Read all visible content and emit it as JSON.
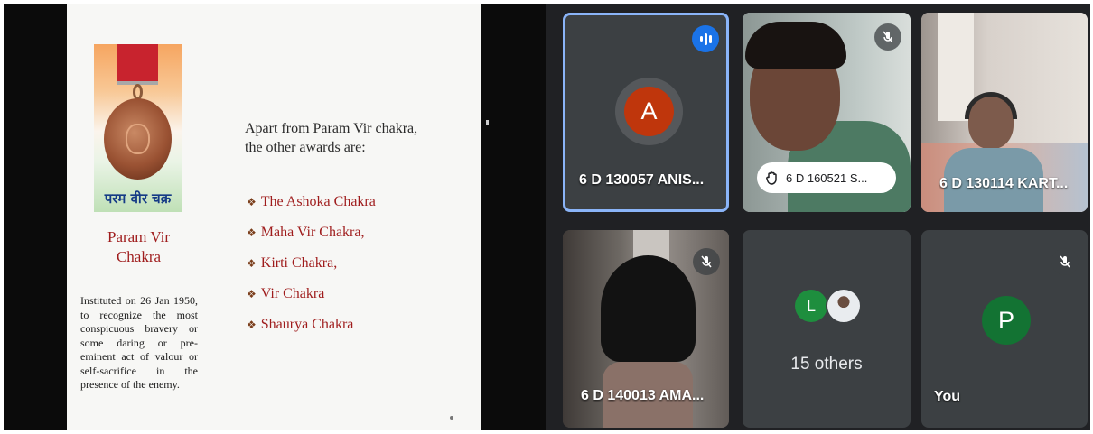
{
  "slide": {
    "medal_hindi": "परम वीर चक्र",
    "award_name_line1": "Param Vir",
    "award_name_line2": "Chakra",
    "description": "Instituted on 26 Jan 1950, to recognize the most conspicuous bravery or some daring or pre-eminent act of valour or self-sacrifice in the presence of the enemy.",
    "intro_line1": "Apart from Param Vir chakra,",
    "intro_line2": "the other awards are:",
    "bullet_symbol": "❖",
    "awards": [
      "The Ashoka Chakra",
      "Maha Vir Chakra,",
      "Kirti Chakra,",
      "Vir Chakra",
      "Shaurya Chakra"
    ]
  },
  "participants": [
    {
      "name": "6 D 130057 ANIS...",
      "initial": "A",
      "avatar_color": "#bf360c",
      "state": "speaking",
      "icon": "audio-wave-icon"
    },
    {
      "name": "6 D 160521 S...",
      "state": "hand-raised",
      "icon": "hand-raised-icon",
      "muted": true
    },
    {
      "name": "6 D 130114 KART...",
      "state": "video"
    },
    {
      "name": "6 D 140013 AMA...",
      "state": "video",
      "muted": true
    },
    {
      "label": "15 others",
      "initial": "L",
      "avatar_color": "#1e8e3e"
    },
    {
      "name": "You",
      "initial": "P",
      "avatar_color": "#137333",
      "muted": true
    }
  ],
  "colors": {
    "accent": "#8ab4f8",
    "tile_bg": "#3c4043",
    "stage_bg": "#202124"
  }
}
